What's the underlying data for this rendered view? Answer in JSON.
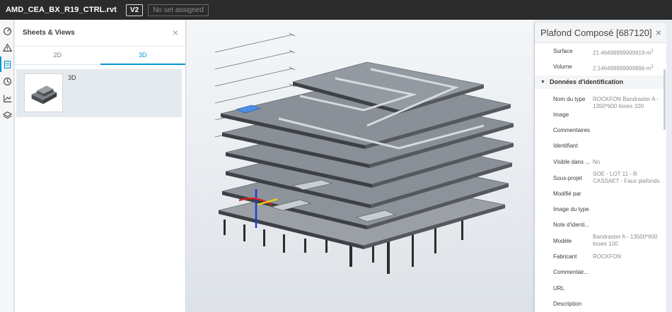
{
  "topbar": {
    "filename": "AMD_CEA_BX_R19_CTRL.rvt",
    "version": "V2",
    "set_selector": "No set assigned"
  },
  "rail": {
    "icons": [
      "dashboard-icon",
      "warning-icon",
      "sheets-icon",
      "history-icon",
      "chart-icon",
      "layers-icon"
    ],
    "active": "sheets-icon"
  },
  "sheets_panel": {
    "title": "Sheets & Views",
    "close": "×",
    "tabs": [
      {
        "label": "2D"
      },
      {
        "label": "3D"
      }
    ],
    "active_tab": "3D",
    "items": [
      {
        "label": "3D"
      }
    ]
  },
  "properties": {
    "title": "Plafond Composé [687120]",
    "close": "×",
    "top_rows": [
      {
        "key": "Surface",
        "value": "21.46499999999919 m",
        "unit_sup": "2"
      },
      {
        "key": "Volume",
        "value": "2.146499999999896 m",
        "unit_sup": "3"
      }
    ],
    "category": "Données d'identification",
    "rows": [
      {
        "key": "Nom du type",
        "value": "ROCKFON Bandraster A - 1350*600 lisses 100"
      },
      {
        "key": "Image",
        "value": ""
      },
      {
        "key": "Commentaires",
        "value": ""
      },
      {
        "key": "Identifiant",
        "value": ""
      },
      {
        "key": "Visible dans ...",
        "value": "No"
      },
      {
        "key": "Sous-projet",
        "value": "SOE - LOT 11 - R CASSAET - Faux plafonds"
      },
      {
        "key": "Modifié par",
        "value": ""
      },
      {
        "key": "Image du type",
        "value": ""
      },
      {
        "key": "Note d'identi...",
        "value": ""
      },
      {
        "key": "Modèle",
        "value": "Bandraster A - 13500*600 lisses 100"
      },
      {
        "key": "Fabricant",
        "value": "ROCKFON"
      },
      {
        "key": "Commentair...",
        "value": ""
      },
      {
        "key": "URL",
        "value": ""
      },
      {
        "key": "Description",
        "value": ""
      }
    ]
  },
  "colors": {
    "accent": "#0696d7",
    "topbar": "#2b2b2b",
    "slab": "#8b9097",
    "slab_top": "#a9aeb4"
  }
}
